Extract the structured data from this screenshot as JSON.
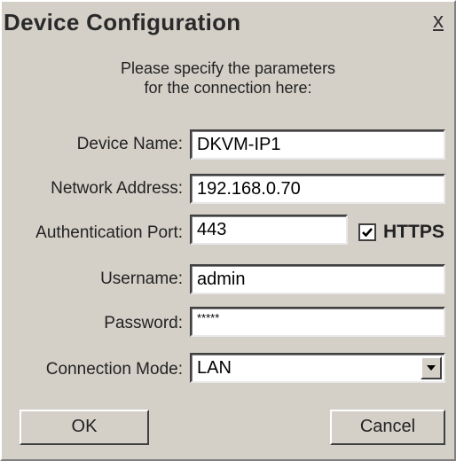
{
  "dialog": {
    "title": "Device Configuration",
    "close_label": "x",
    "intro_line1": "Please specify the parameters",
    "intro_line2": "for the connection here:"
  },
  "form": {
    "device_name": {
      "label": "Device Name:",
      "value": "DKVM-IP1"
    },
    "network_address": {
      "label": "Network Address:",
      "value": "192.168.0.70"
    },
    "auth_port": {
      "label": "Authentication Port:",
      "value": "443"
    },
    "https": {
      "label": "HTTPS",
      "checked": true
    },
    "username": {
      "label": "Username:",
      "value": "admin"
    },
    "password": {
      "label": "Password:",
      "value": "*****"
    },
    "connection_mode": {
      "label": "Connection Mode:",
      "value": "LAN"
    }
  },
  "buttons": {
    "ok": "OK",
    "cancel": "Cancel"
  },
  "icons": {
    "close": "close-icon",
    "check": "checkmark-icon",
    "dropdown": "chevron-down-icon"
  }
}
